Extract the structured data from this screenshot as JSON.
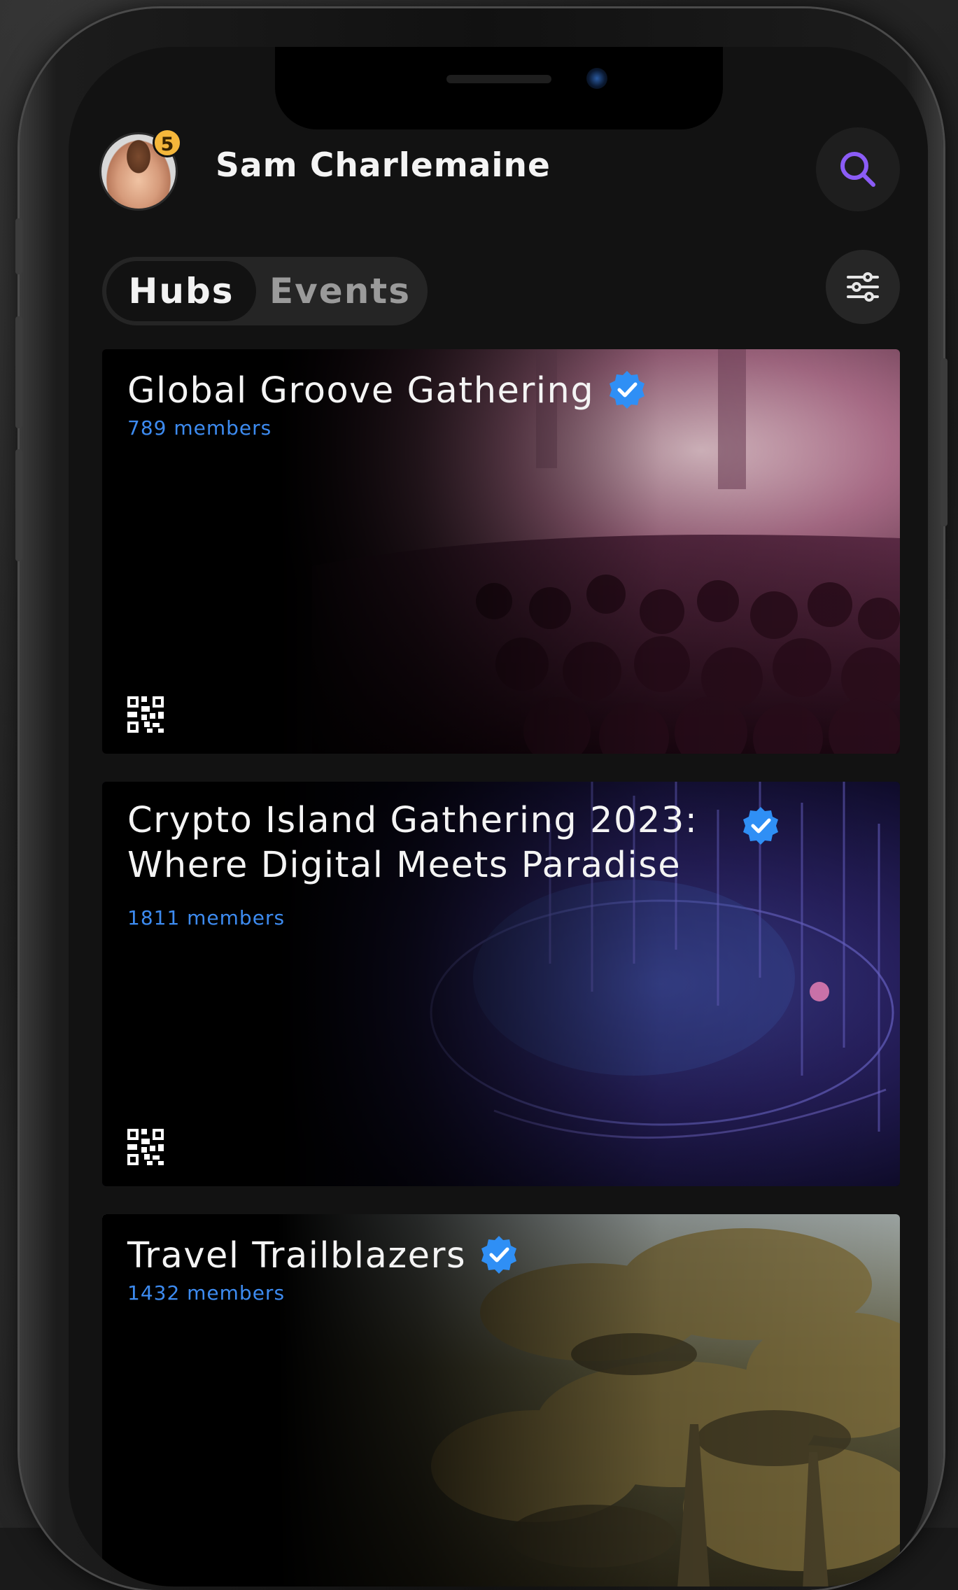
{
  "header": {
    "user_name": "Sam Charlemaine",
    "notification_count": "5",
    "search_icon": "search-icon",
    "accent_color": "#8b5cf6"
  },
  "tabs": {
    "items": [
      {
        "label": "Hubs",
        "selected": true
      },
      {
        "label": "Events",
        "selected": false
      }
    ],
    "filter_icon": "sliders-icon"
  },
  "hubs": [
    {
      "title": "Global Groove Gathering",
      "members": "789 members",
      "verified": true,
      "qr_icon": "qr-code-icon"
    },
    {
      "title": "Crypto Island Gathering 2023: Where Digital Meets Paradise",
      "members": "1811 members",
      "verified": true,
      "qr_icon": "qr-code-icon"
    },
    {
      "title": "Travel Trailblazers",
      "members": "1432 members",
      "verified": true
    }
  ],
  "colors": {
    "verified_badge": "#2f8ff5",
    "members_text": "#3d8bf0",
    "badge": "#f5b73b"
  }
}
